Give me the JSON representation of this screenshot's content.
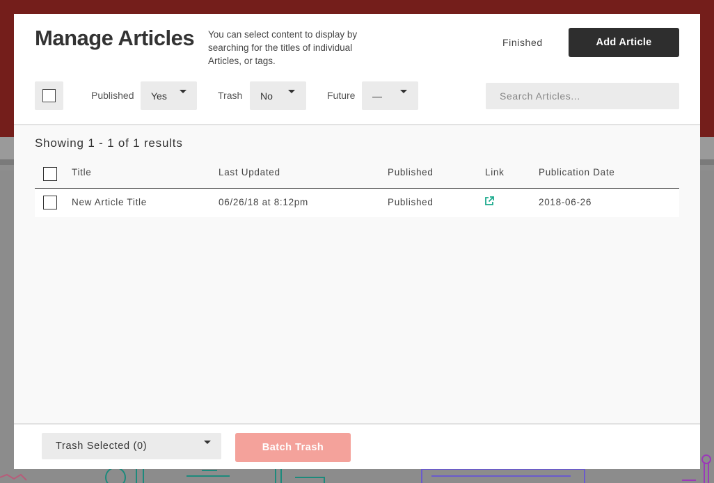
{
  "modal": {
    "title": "Manage Articles",
    "description": "You can select content to display by searching for the titles of individual Articles, or tags.",
    "finished_label": "Finished",
    "add_label": "Add Article"
  },
  "filters": {
    "published": {
      "label": "Published",
      "value": "Yes"
    },
    "trash": {
      "label": "Trash",
      "value": "No"
    },
    "future": {
      "label": "Future",
      "value": "—"
    },
    "search_placeholder": "Search Articles..."
  },
  "results": {
    "showing": "Showing 1 - 1 of 1 results",
    "columns": [
      "Title",
      "Last Updated",
      "Published",
      "Link",
      "Publication Date"
    ],
    "rows": [
      {
        "title": "New Article Title",
        "last_updated": "06/26/18 at 8:12pm",
        "published": "Published",
        "link_icon": "external-link-icon",
        "publication_date": "2018-06-26"
      }
    ]
  },
  "footer": {
    "bulk_action": "Trash Selected (0)",
    "batch_label": "Batch Trash"
  },
  "colors": {
    "header_bg": "#741e1b",
    "primary_button": "#2e2e2e",
    "batch_button_disabled": "#f4a29b",
    "link_accent": "#1aa98c"
  }
}
